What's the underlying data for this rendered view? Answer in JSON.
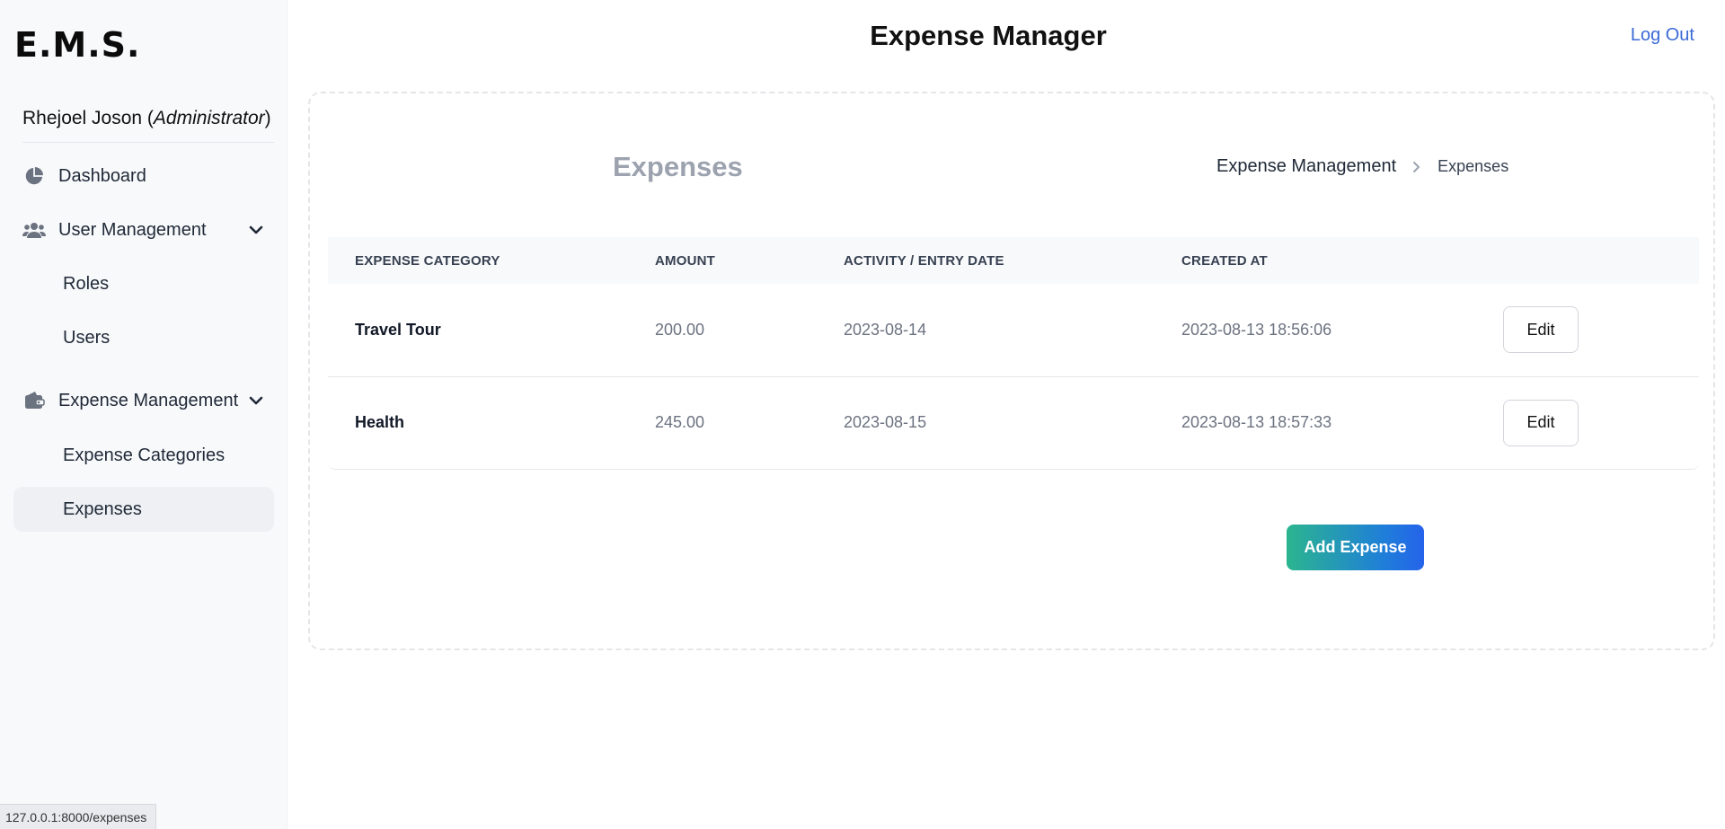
{
  "app": {
    "logo": "E.M.S.",
    "user": {
      "name": "Rhejoel Joson",
      "role": "Administrator"
    },
    "status_url": "127.0.0.1:8000/expenses"
  },
  "header": {
    "title": "Expense Manager",
    "logout_label": "Log Out",
    "link_color": "#3b6ad6"
  },
  "sidebar": {
    "items": [
      {
        "label": "Dashboard",
        "icon": "pie-chart-icon"
      },
      {
        "label": "User Management",
        "icon": "users-icon",
        "expanded": true,
        "children": [
          {
            "label": "Roles"
          },
          {
            "label": "Users"
          }
        ]
      },
      {
        "label": "Expense Management",
        "icon": "wallet-icon",
        "expanded": true,
        "children": [
          {
            "label": "Expense Categories"
          },
          {
            "label": "Expenses",
            "active": true
          }
        ]
      }
    ]
  },
  "main": {
    "section_title": "Expenses",
    "breadcrumb": {
      "parent": "Expense Management",
      "current": "Expenses"
    },
    "table": {
      "headers": [
        "EXPENSE CATEGORY",
        "AMOUNT",
        "ACTIVITY / ENTRY DATE",
        "CREATED AT"
      ],
      "rows": [
        {
          "category": "Travel Tour",
          "amount": "200.00",
          "entry_date": "2023-08-14",
          "created_at": "2023-08-13 18:56:06",
          "action": "Edit"
        },
        {
          "category": "Health",
          "amount": "245.00",
          "entry_date": "2023-08-15",
          "created_at": "2023-08-13 18:57:33",
          "action": "Edit"
        }
      ]
    },
    "add_button_label": "Add Expense"
  }
}
